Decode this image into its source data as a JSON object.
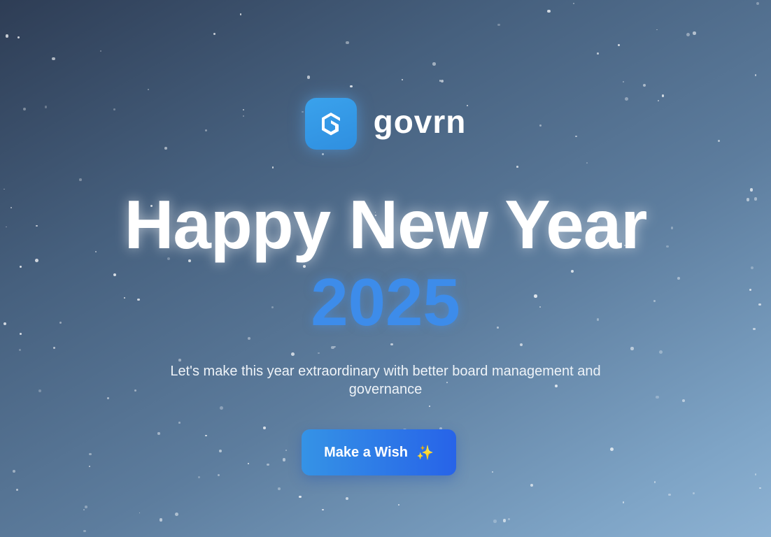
{
  "brand": {
    "name": "govrn",
    "logo_icon": "govrn-logo-icon",
    "logo_color": "#3aa2ec"
  },
  "hero": {
    "title": "Happy New Year",
    "year": "2025",
    "year_color": "#3d8cea",
    "tagline": "Let's make this year extraordinary with better board management and governance"
  },
  "cta": {
    "label": "Make a Wish",
    "icon": "sparkles-icon",
    "icon_glyph": "✨",
    "gradient": [
      "#3593e6",
      "#2763e8"
    ]
  },
  "background": {
    "gradient": [
      "#2e3d55",
      "#8db2d3"
    ],
    "decoration": "stars"
  }
}
